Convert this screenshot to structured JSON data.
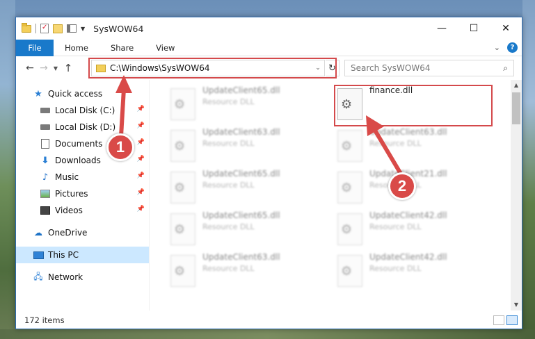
{
  "window": {
    "title": "SysWOW64",
    "controls": {
      "minimize": "—",
      "maximize": "☐",
      "close": "✕"
    }
  },
  "ribbon": {
    "tabs": [
      {
        "label": "File",
        "active": true
      },
      {
        "label": "Home"
      },
      {
        "label": "Share"
      },
      {
        "label": "View"
      }
    ],
    "help": "?"
  },
  "navbar": {
    "back": "←",
    "forward": "→",
    "up": "↑",
    "address": "C:\\Windows\\SysWOW64",
    "refresh": "↻",
    "search_placeholder": "Search SysWOW64"
  },
  "sidebar": {
    "items": [
      {
        "label": "Quick access",
        "icon": "star-icon"
      },
      {
        "label": "Local Disk (C:)",
        "icon": "drive-icon",
        "pinned": true
      },
      {
        "label": "Local Disk (D:)",
        "icon": "drive-icon",
        "pinned": true
      },
      {
        "label": "Documents",
        "icon": "documents-icon",
        "pinned": true
      },
      {
        "label": "Downloads",
        "icon": "download-icon",
        "pinned": true
      },
      {
        "label": "Music",
        "icon": "music-icon",
        "pinned": true
      },
      {
        "label": "Pictures",
        "icon": "pictures-icon",
        "pinned": true
      },
      {
        "label": "Videos",
        "icon": "videos-icon",
        "pinned": true
      },
      {
        "label": "OneDrive",
        "icon": "cloud-icon"
      },
      {
        "label": "This PC",
        "icon": "computer-icon",
        "selected": true
      },
      {
        "label": "Network",
        "icon": "network-icon"
      }
    ]
  },
  "files": [
    {
      "name": "UpdateClient65.dll",
      "type": "Resource DLL"
    },
    {
      "name": "finance.dll",
      "type": ""
    },
    {
      "name": "UpdateClient63.dll",
      "type": "Resource DLL"
    },
    {
      "name": "UpdateClient63.dll",
      "type": "Resource DLL"
    },
    {
      "name": "UpdateClient65.dll",
      "type": "Resource DLL"
    },
    {
      "name": "UpdateClient21.dll",
      "type": "Resource DLL"
    },
    {
      "name": "UpdateClient65.dll",
      "type": "Resource DLL"
    },
    {
      "name": "UpdateClient42.dll",
      "type": "Resource DLL"
    },
    {
      "name": "UpdateClient63.dll",
      "type": "Resource DLL"
    },
    {
      "name": "UpdateClient42.dll",
      "type": "Resource DLL"
    }
  ],
  "status": {
    "item_count": "172 items"
  },
  "callouts": {
    "step1": "1",
    "step2": "2"
  },
  "colors": {
    "accent": "#1979ca",
    "highlight": "#d4494b",
    "selection": "#cce8ff"
  }
}
